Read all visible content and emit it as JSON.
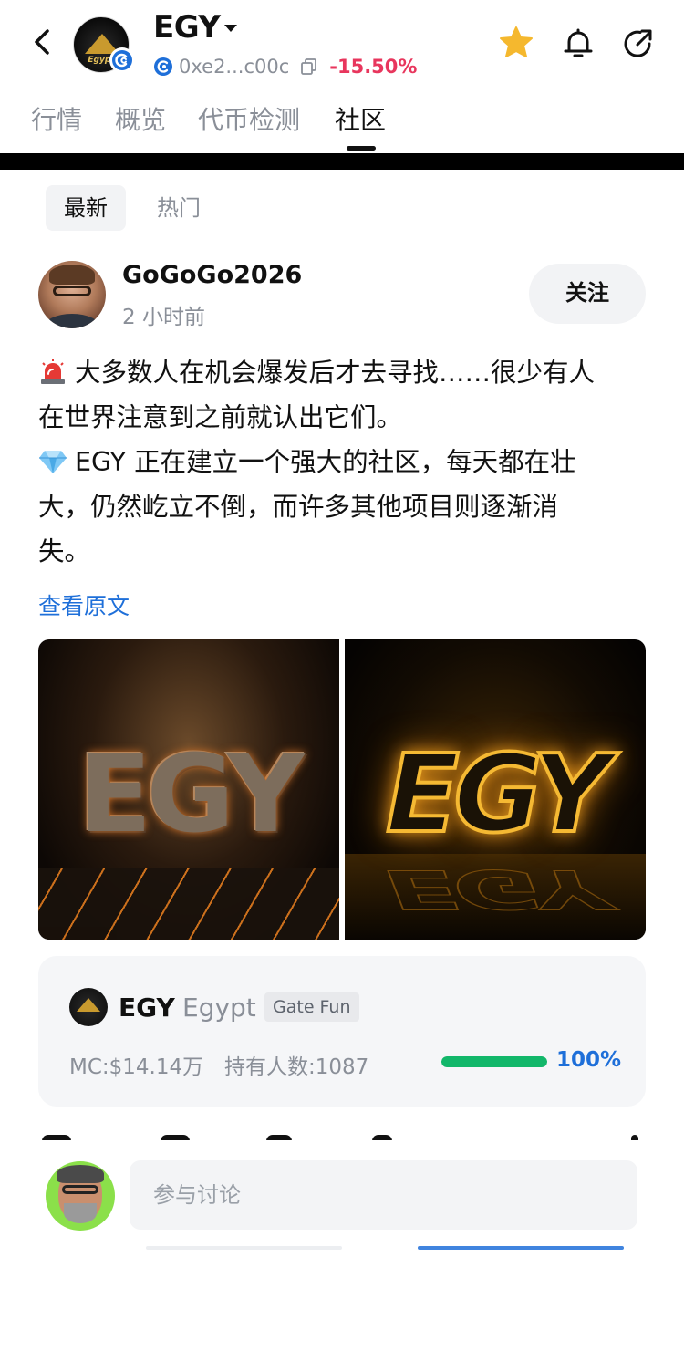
{
  "header": {
    "title": "EGY",
    "logo_text": "Egypt",
    "address": "0xe2...c00c",
    "change_pct": "-15.50%",
    "icons": {
      "back": "chevron-left-icon",
      "star": "star-icon",
      "bell": "bell-icon",
      "share": "share-icon",
      "copy": "copy-icon",
      "chain": "chain-badge-icon"
    },
    "colors": {
      "negative": "#e8365d",
      "star": "#f5b82e"
    }
  },
  "tabs": [
    "行情",
    "概览",
    "代币检测",
    "社区"
  ],
  "active_tab": "社区",
  "filters": {
    "latest": "最新",
    "hot": "热门"
  },
  "post": {
    "username": "GoGoGo2026",
    "timestamp": "2 小时前",
    "follow_label": "关注",
    "lines": [
      "大多数人在机会爆发后才去寻找……很少有人",
      "在世界注意到之前就认出它们。",
      "EGY 正在建立一个强大的社区，每天都在壮",
      "大，仍然屹立不倒，而许多其他项目则逐渐消",
      "失。"
    ],
    "view_original": "查看原文",
    "image_text": [
      "EGY",
      "EGY"
    ]
  },
  "token_card": {
    "symbol": "EGY",
    "name": "Egypt",
    "tag": "Gate Fun",
    "mc": "MC:$14.14万",
    "holders": "持有人数:1087",
    "progress": 1.0,
    "progress_label": "100%",
    "colors": {
      "progress": "#12b76a",
      "link": "#1e6fd9"
    }
  },
  "comment": {
    "placeholder": "参与讨论"
  }
}
